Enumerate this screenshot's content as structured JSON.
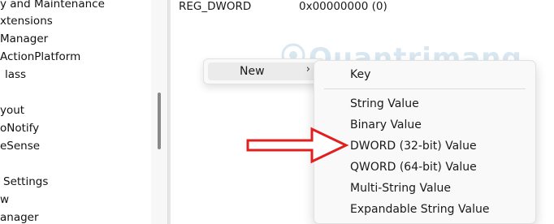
{
  "tree": {
    "items": [
      {
        "label": "y and Maintenance"
      },
      {
        "label": "xtensions"
      },
      {
        "label": "Manager"
      },
      {
        "label": "ActionPlatform"
      },
      {
        "label": "lass"
      },
      {
        "label": "yout"
      },
      {
        "label": "oNotify"
      },
      {
        "label": "eSense"
      },
      {
        "label": "Settings"
      },
      {
        "label": "w"
      },
      {
        "label": "anager"
      }
    ]
  },
  "values_row": {
    "type": "REG_DWORD",
    "data": "0x00000000 (0)"
  },
  "context_menu": {
    "new_label": "New",
    "new_chevron": "›"
  },
  "submenu": {
    "key_label": "Key",
    "items": [
      {
        "label": "String Value"
      },
      {
        "label": "Binary Value"
      },
      {
        "label": "DWORD (32-bit) Value"
      },
      {
        "label": "QWORD (64-bit) Value"
      },
      {
        "label": "Multi-String Value"
      },
      {
        "label": "Expandable String Value"
      }
    ]
  },
  "watermark": {
    "text": "Quantrimang"
  },
  "colors": {
    "arrow": "#e0201e",
    "menu_bg": "#f9f9f9",
    "hover_bg": "#ebebeb"
  }
}
